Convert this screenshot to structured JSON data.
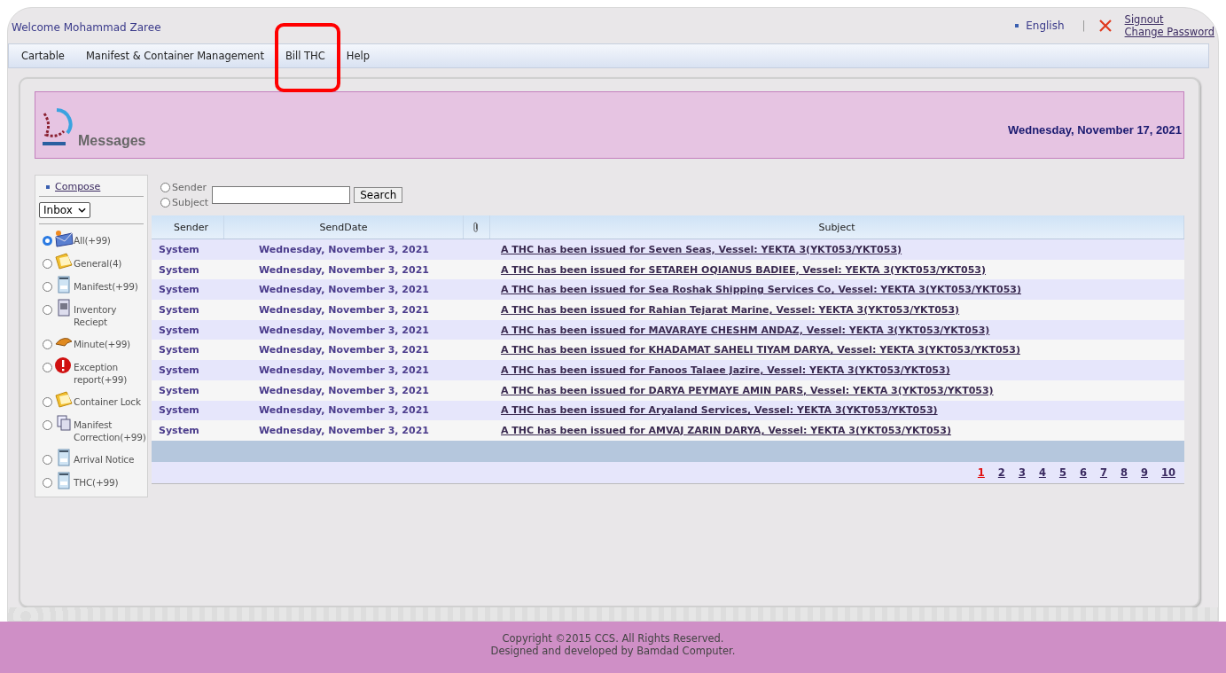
{
  "header": {
    "welcome": "Welcome Mohammad Zaree",
    "language": "English",
    "separator": "|",
    "signout": "Signout",
    "change_password": "Change Password"
  },
  "menu": [
    {
      "label": "Cartable",
      "highlighted": false
    },
    {
      "label": "Manifest & Container Management",
      "highlighted": false
    },
    {
      "label": "Bill THC",
      "highlighted": true
    },
    {
      "label": "Help",
      "highlighted": false
    }
  ],
  "banner": {
    "title": "Messages",
    "date": "Wednesday, November 17, 2021"
  },
  "sidebar": {
    "compose": "Compose",
    "folder_select": "Inbox",
    "folders": [
      {
        "label": "All(+99)",
        "kind": "mail",
        "selected": true
      },
      {
        "label": "General(4)",
        "kind": "folder",
        "selected": false
      },
      {
        "label": "Manifest(+99)",
        "kind": "form",
        "selected": false
      },
      {
        "label": "Inventory Reciept",
        "kind": "receipt",
        "selected": false
      },
      {
        "label": "Minute(+99)",
        "kind": "hand",
        "selected": false
      },
      {
        "label": "Exception report(+99)",
        "kind": "alert",
        "selected": false
      },
      {
        "label": "Container Lock",
        "kind": "folder",
        "selected": false
      },
      {
        "label": "Manifest Correction(+99)",
        "kind": "copy",
        "selected": false
      },
      {
        "label": "Arrival Notice",
        "kind": "form",
        "selected": false
      },
      {
        "label": "THC(+99)",
        "kind": "form",
        "selected": false
      }
    ]
  },
  "search": {
    "options": [
      {
        "label": "Sender",
        "selected": false
      },
      {
        "label": "Subject",
        "selected": false
      }
    ],
    "button": "Search"
  },
  "table": {
    "columns": [
      "Sender",
      "SendDate",
      "Subject"
    ],
    "rows": [
      {
        "sender": "System",
        "date": "Wednesday, November 3, 2021",
        "subject": "A THC has been issued for Seven Seas, Vessel: YEKTA 3(YKT053/YKT053)"
      },
      {
        "sender": "System",
        "date": "Wednesday, November 3, 2021",
        "subject": "A THC has been issued for SETAREH OQIANUS BADIEE, Vessel: YEKTA 3(YKT053/YKT053)"
      },
      {
        "sender": "System",
        "date": "Wednesday, November 3, 2021",
        "subject": "A THC has been issued for Sea Roshak Shipping Services Co, Vessel: YEKTA 3(YKT053/YKT053)"
      },
      {
        "sender": "System",
        "date": "Wednesday, November 3, 2021",
        "subject": "A THC has been issued for Rahian Tejarat Marine, Vessel: YEKTA 3(YKT053/YKT053)"
      },
      {
        "sender": "System",
        "date": "Wednesday, November 3, 2021",
        "subject": "A THC has been issued for MAVARAYE CHESHM ANDAZ, Vessel: YEKTA 3(YKT053/YKT053)"
      },
      {
        "sender": "System",
        "date": "Wednesday, November 3, 2021",
        "subject": "A THC has been issued for KHADAMAT SAHELI TIYAM DARYA, Vessel: YEKTA 3(YKT053/YKT053)"
      },
      {
        "sender": "System",
        "date": "Wednesday, November 3, 2021",
        "subject": "A THC has been issued for Fanoos Talaee Jazire, Vessel: YEKTA 3(YKT053/YKT053)"
      },
      {
        "sender": "System",
        "date": "Wednesday, November 3, 2021",
        "subject": "A THC has been issued for DARYA PEYMAYE AMIN PARS, Vessel: YEKTA 3(YKT053/YKT053)"
      },
      {
        "sender": "System",
        "date": "Wednesday, November 3, 2021",
        "subject": "A THC has been issued for Aryaland Services, Vessel: YEKTA 3(YKT053/YKT053)"
      },
      {
        "sender": "System",
        "date": "Wednesday, November 3, 2021",
        "subject": "A THC has been issued for AMVAJ ZARIN DARYA, Vessel: YEKTA 3(YKT053/YKT053)"
      }
    ]
  },
  "pagination": [
    {
      "label": "1",
      "selected": true
    },
    {
      "label": "2",
      "selected": false
    },
    {
      "label": "3",
      "selected": false
    },
    {
      "label": "4",
      "selected": false
    },
    {
      "label": "5",
      "selected": false
    },
    {
      "label": "6",
      "selected": false
    },
    {
      "label": "7",
      "selected": false
    },
    {
      "label": "8",
      "selected": false
    },
    {
      "label": "9",
      "selected": false
    },
    {
      "label": "10",
      "selected": false
    }
  ],
  "footer": {
    "copyright": "Copyright ©2015 CCS. All Rights Reserved.",
    "credit": "Designed and developed by Bamdad Computer."
  }
}
